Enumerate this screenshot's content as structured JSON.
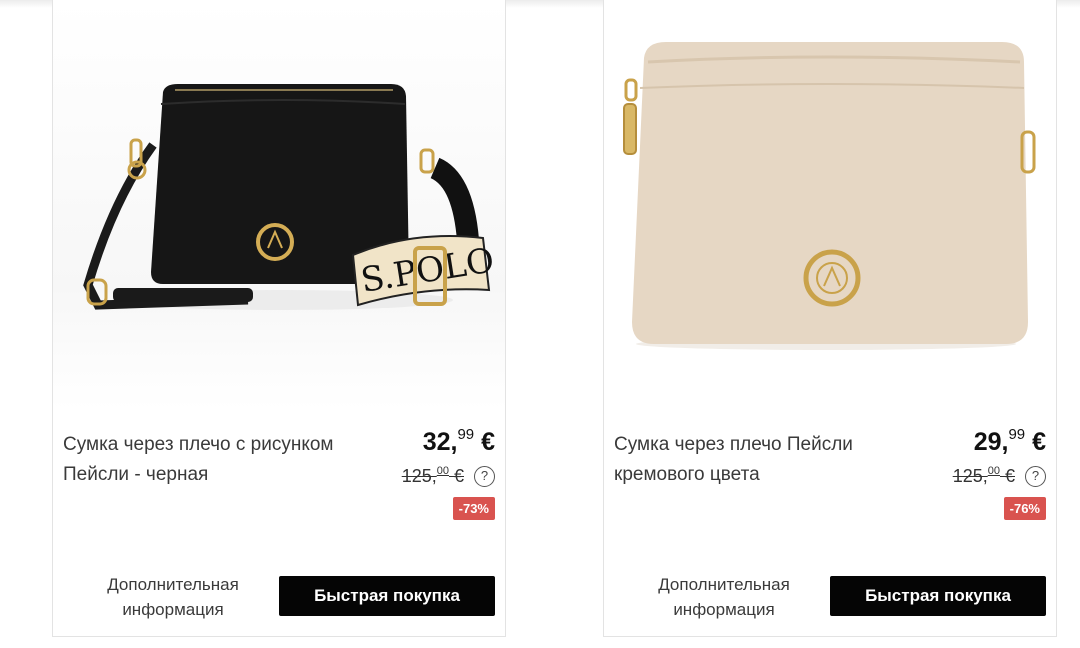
{
  "products": [
    {
      "title": "Сумка через плечо с рисунком Пейсли - черная",
      "price_main": "32,",
      "price_cents": "99",
      "price_currency": " €",
      "old_price_main": "125,",
      "old_price_cents": "00",
      "old_price_currency": " €",
      "help": "?",
      "discount": "-73%",
      "more_info": "Дополнительная информация",
      "quick_buy": "Быстрая покупка",
      "strap_text": "S.POLO"
    },
    {
      "title": "Сумка через плечо Пейсли кремового цвета",
      "price_main": "29,",
      "price_cents": "99",
      "price_currency": " €",
      "old_price_main": "125,",
      "old_price_cents": "00",
      "old_price_currency": " €",
      "help": "?",
      "discount": "-76%",
      "more_info": "Дополнительная информация",
      "quick_buy": "Быстрая покупка"
    }
  ],
  "colors": {
    "discount_badge": "#d9534f",
    "button": "#050505",
    "black_bag": "#161616",
    "cream_bag": "#e6d7c4",
    "gold": "#c9a24a"
  }
}
